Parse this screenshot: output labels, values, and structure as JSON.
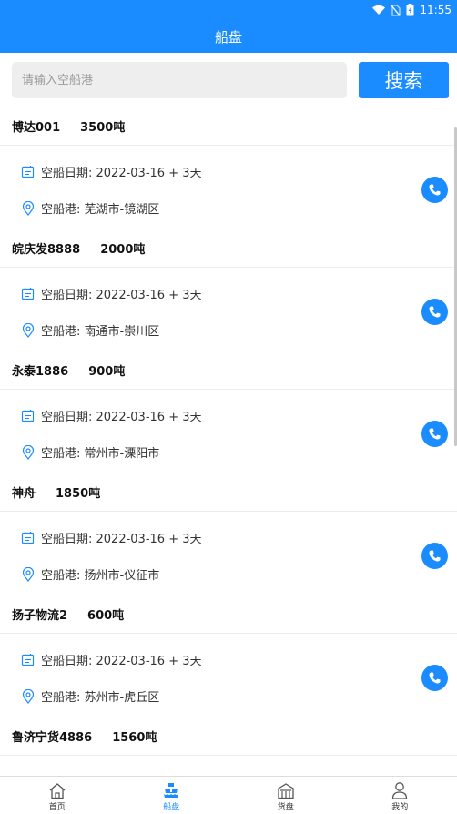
{
  "status_bar": {
    "time": "11:55"
  },
  "app_bar": {
    "title": "船盘"
  },
  "search": {
    "placeholder": "请输入空船港",
    "value": "",
    "button_label": "搜索"
  },
  "ships": [
    {
      "name": "博达001",
      "tonnage": "3500吨",
      "date_label": "空船日期: 2022-03-16 + 3天",
      "port_label": "空船港: 芜湖市-镜湖区"
    },
    {
      "name": "皖庆发8888",
      "tonnage": "2000吨",
      "date_label": "空船日期: 2022-03-16 + 3天",
      "port_label": "空船港: 南通市-崇川区"
    },
    {
      "name": "永泰1886",
      "tonnage": "900吨",
      "date_label": "空船日期: 2022-03-16 + 3天",
      "port_label": "空船港: 常州市-溧阳市"
    },
    {
      "name": "神舟",
      "tonnage": "1850吨",
      "date_label": "空船日期: 2022-03-16 + 3天",
      "port_label": "空船港: 扬州市-仪征市"
    },
    {
      "name": "扬子物流2",
      "tonnage": "600吨",
      "date_label": "空船日期: 2022-03-16 + 3天",
      "port_label": "空船港: 苏州市-虎丘区"
    },
    {
      "name": "鲁济宁货4886",
      "tonnage": "1560吨"
    }
  ],
  "tabs": [
    {
      "label": "首页",
      "icon": "home-icon"
    },
    {
      "label": "船盘",
      "icon": "ship-icon",
      "active": true
    },
    {
      "label": "货盘",
      "icon": "warehouse-icon"
    },
    {
      "label": "我的",
      "icon": "person-icon"
    }
  ],
  "colors": {
    "primary": "#1a8cff",
    "divider": "#e4e4e4",
    "search_bg": "#eeeeee"
  }
}
